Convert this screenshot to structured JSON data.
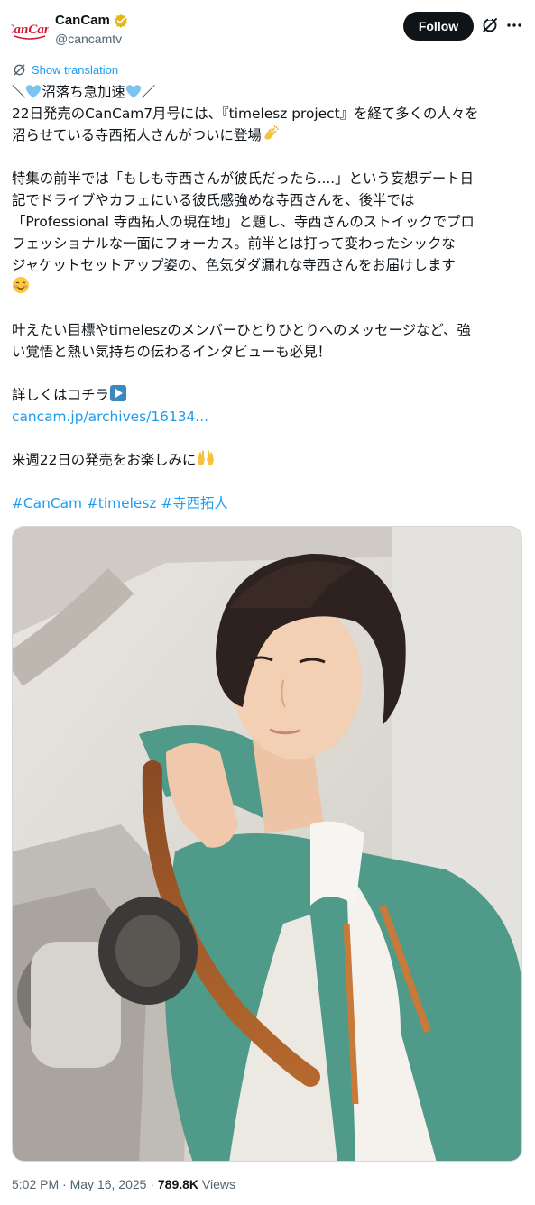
{
  "header": {
    "display_name": "CanCam",
    "handle": "@cancamtv",
    "avatar_text": "CanCam",
    "follow_label": "Follow",
    "verified": true
  },
  "translate_label": "Show translation",
  "tweet": {
    "line1_a": "＼",
    "line1_b": "沼落ち急加速",
    "line1_c": "／",
    "line2": "22日発売のCanCam7月号には、『timelesz project』を経て多くの人々を",
    "line3": "沼らせている寺西拓人さんがついに登場",
    "line4": "特集の前半では「もしも寺西さんが彼氏だったら....」という妄想デート日",
    "line5": "記でドライブやカフェにいる彼氏感強めな寺西さんを、後半では",
    "line6": "「Professional 寺西拓人の現在地」と題し、寺西さんのストイックでプロ",
    "line7": "フェッショナルな一面にフォーカス。前半とは打って変わったシックな",
    "line8": "ジャケットセットアップ姿の、色気ダダ漏れな寺西さんをお届けします",
    "line9": "叶えたい目標やtimeleszのメンバーひとりひとりへのメッセージなど、強",
    "line10": "い覚悟と熱い気持ちの伝わるインタビューも必見！",
    "line11": "詳しくはコチラ",
    "link": "cancam.jp/archives/16134...",
    "line12": "来週22日の発売をお楽しみに",
    "hashtag1": "#CanCam",
    "hashtag2": "#timelesz",
    "hashtag3": "#寺西拓人"
  },
  "footer": {
    "time": "5:02 PM",
    "sep1": " · ",
    "date": "May 16, 2025",
    "sep2": " · ",
    "views_count": "789.8K",
    "views_label": " Views"
  },
  "colors": {
    "accent": "#1d9bf0",
    "text": "#0f1419",
    "muted": "#536471",
    "brand_red": "#d7172f",
    "verified_gold": "#e2b719"
  },
  "icons": [
    "verified-badge-icon",
    "grok-icon",
    "more-icon",
    "translate-globe-icon",
    "blue-heart-icon",
    "clapping-hands-icon",
    "smiling-face-icon",
    "play-button-icon",
    "raising-hands-icon"
  ]
}
